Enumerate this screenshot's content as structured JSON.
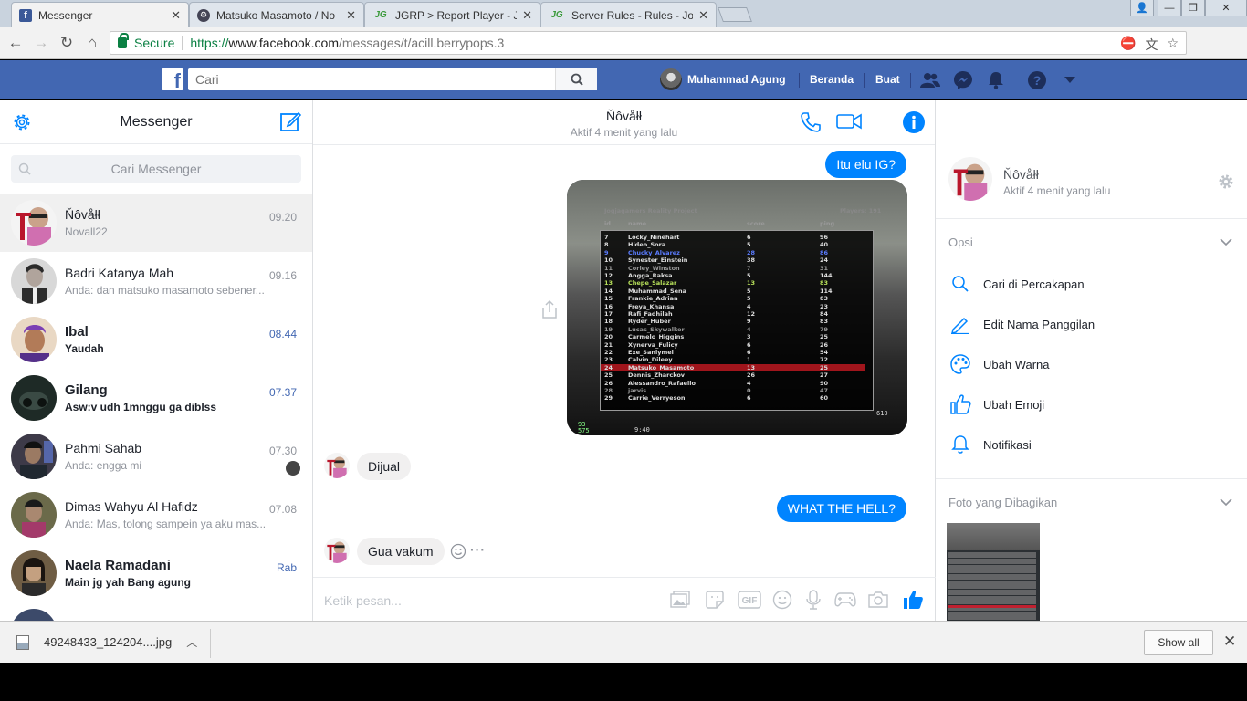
{
  "browser": {
    "tabs": [
      {
        "title": "Messenger",
        "icon": "facebook-icon",
        "active": true
      },
      {
        "title": "Matsuko Masamoto / No",
        "icon": "game-icon",
        "active": false
      },
      {
        "title": "JGRP > Report Player - Jo",
        "icon": "jgrp-icon",
        "active": false
      },
      {
        "title": "Server Rules - Rules - Joo",
        "icon": "jgrp-icon",
        "active": false
      }
    ],
    "secure_label": "Secure",
    "url": {
      "scheme": "https://",
      "host": "www.facebook.com",
      "path": "/messages/t/acill.berrypops.3"
    }
  },
  "fb": {
    "search_placeholder": "Cari",
    "user_name": "Muhammad Agung",
    "nav_home": "Beranda",
    "nav_create": "Buat"
  },
  "left": {
    "title": "Messenger",
    "search_placeholder": "Cari Messenger",
    "conversations": [
      {
        "name": "Ňôvåłł",
        "snippet": "Novall22",
        "time": "09.20",
        "unread": false,
        "active": true
      },
      {
        "name": "Badri Katanya Mah",
        "snippet": "Anda: dan matsuko masamoto sebener...",
        "time": "09.16",
        "unread": false,
        "active": false
      },
      {
        "name": "Ibal",
        "snippet": "Yaudah",
        "time": "08.44",
        "unread": true,
        "active": false
      },
      {
        "name": "Gilang",
        "snippet": "Asw:v udh 1mnggu ga diblss",
        "time": "07.37",
        "unread": true,
        "active": false
      },
      {
        "name": "Pahmi Sahab",
        "snippet": "Anda: engga mi",
        "time": "07.30",
        "unread": false,
        "active": false
      },
      {
        "name": "Dimas Wahyu Al Hafidz",
        "snippet": "Anda: Mas, tolong sampein ya aku mas...",
        "time": "07.08",
        "unread": false,
        "active": false
      },
      {
        "name": "Naela Ramadani",
        "snippet": "Main jg yah Bang agung",
        "time": "Rab",
        "unread": true,
        "active": false
      }
    ]
  },
  "chat": {
    "contact_name": "Ňôvåłł",
    "contact_status": "Aktif 4 menit yang lalu",
    "messages": {
      "m1": "Itu elu IG?",
      "m2": "Dijual",
      "m3": "WHAT THE HELL?",
      "m4": "Gua vakum"
    },
    "composer_placeholder": "Ketik pesan...",
    "scoreboard": {
      "header": {
        "id": "id",
        "name": "name",
        "score": "score",
        "ping": "ping",
        "server": "Jogjagamers Reality Project",
        "players": "Players: 191"
      },
      "rows": [
        {
          "id": "7",
          "name": "Locky_Ninehart",
          "score": "6",
          "ping": "96",
          "style": ""
        },
        {
          "id": "8",
          "name": "Hideo_Sora",
          "score": "5",
          "ping": "40",
          "style": ""
        },
        {
          "id": "9",
          "name": "Chucky_Alvarez",
          "score": "28",
          "ping": "86",
          "style": "blue"
        },
        {
          "id": "10",
          "name": "Synester_Einstein",
          "score": "38",
          "ping": "24",
          "style": ""
        },
        {
          "id": "11",
          "name": "Corley_Winston",
          "score": "7",
          "ping": "31",
          "style": "gray"
        },
        {
          "id": "12",
          "name": "Angga_Raksa",
          "score": "5",
          "ping": "144",
          "style": ""
        },
        {
          "id": "13",
          "name": "Chepe_Salazar",
          "score": "13",
          "ping": "83",
          "style": "green"
        },
        {
          "id": "14",
          "name": "Muhammad_Sena",
          "score": "5",
          "ping": "114",
          "style": ""
        },
        {
          "id": "15",
          "name": "Frankie_Adrian",
          "score": "5",
          "ping": "83",
          "style": ""
        },
        {
          "id": "16",
          "name": "Freya_Khansa",
          "score": "4",
          "ping": "23",
          "style": ""
        },
        {
          "id": "17",
          "name": "Rafi_Fadhilah",
          "score": "12",
          "ping": "84",
          "style": ""
        },
        {
          "id": "18",
          "name": "Ryder_Huber",
          "score": "9",
          "ping": "83",
          "style": ""
        },
        {
          "id": "19",
          "name": "Lucas_Skywalker",
          "score": "4",
          "ping": "79",
          "style": "gray"
        },
        {
          "id": "20",
          "name": "Carmelo_Higgins",
          "score": "3",
          "ping": "25",
          "style": ""
        },
        {
          "id": "21",
          "name": "Xynerva_Fulicy",
          "score": "6",
          "ping": "26",
          "style": ""
        },
        {
          "id": "22",
          "name": "Exe_Sanlymel",
          "score": "6",
          "ping": "54",
          "style": ""
        },
        {
          "id": "23",
          "name": "Calvin_Dileey",
          "score": "1",
          "ping": "72",
          "style": ""
        },
        {
          "id": "24",
          "name": "Matsuko_Masamoto",
          "score": "13",
          "ping": "25",
          "style": "hl"
        },
        {
          "id": "25",
          "name": "Dennis_Zharckov",
          "score": "26",
          "ping": "27",
          "style": ""
        },
        {
          "id": "26",
          "name": "Alessandro_Rafaello",
          "score": "4",
          "ping": "90",
          "style": ""
        },
        {
          "id": "28",
          "name": "jarvis",
          "score": "0",
          "ping": "47",
          "style": "gray"
        },
        {
          "id": "29",
          "name": "Carrie_Verryeson",
          "score": "6",
          "ping": "60",
          "style": ""
        }
      ],
      "hud_left": "93",
      "hud_left2": "575",
      "hud_time": "9:40",
      "hud_right": "610"
    }
  },
  "right": {
    "name": "Ňôvåłł",
    "status": "Aktif 4 menit yang lalu",
    "options_title": "Opsi",
    "options": [
      {
        "label": "Cari di Percakapan",
        "icon": "search-icon"
      },
      {
        "label": "Edit Nama Panggilan",
        "icon": "pencil-icon"
      },
      {
        "label": "Ubah Warna",
        "icon": "palette-icon"
      },
      {
        "label": "Ubah Emoji",
        "icon": "thumbs-up-icon"
      },
      {
        "label": "Notifikasi",
        "icon": "bell-icon"
      }
    ],
    "shared_title": "Foto yang Dibagikan"
  },
  "downloads": {
    "file": "49248433_124204....jpg",
    "show_all": "Show all"
  },
  "colors": {
    "fb_blue": "#4267b2",
    "messenger_blue": "#0084ff",
    "bubble_gray": "#f1f0f0"
  }
}
